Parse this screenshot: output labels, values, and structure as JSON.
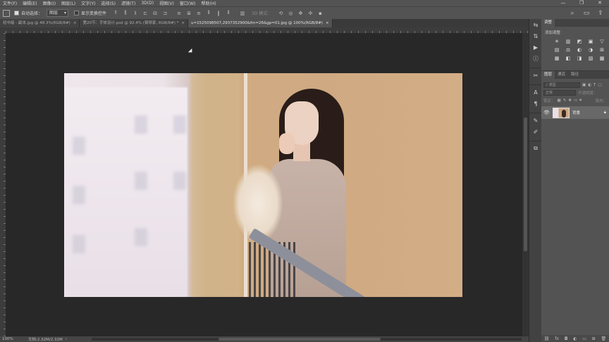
{
  "menu": [
    "文件(F)",
    "编辑(E)",
    "图像(I)",
    "图层(L)",
    "文字(Y)",
    "选择(S)",
    "滤镜(T)",
    "3D(D)",
    "视图(V)",
    "窗口(W)",
    "帮助(H)"
  ],
  "window_controls": [
    "—",
    "❐",
    "✕"
  ],
  "options": {
    "auto_select_label": "自动选择：",
    "auto_select_value": "图层",
    "show_transform_label": "显示变换控件",
    "mode_3d_label": "3D 模式："
  },
  "tabs": [
    {
      "label": "初中级 - 副本.jpg @ 48.3%(RGB/8#)",
      "active": false
    },
    {
      "label": "第20节：字体设计.psd @ 92.4% (钢琴家, RGB/8#) *",
      "active": false
    },
    {
      "label": "u=1525098507,2937352900&fm=26&gp=01.jpg @ 100%(RGB/8#)",
      "active": true
    }
  ],
  "status": {
    "zoom": "100%",
    "doc": "文档:2.32M/2.32M"
  },
  "panels": {
    "top_tabs": [
      "调整"
    ],
    "adjust_title": "添加调整",
    "adjust_icons": [
      "☀",
      "▥",
      "◩",
      "▣",
      "▽",
      "▤",
      "⚖",
      "◐",
      "◑",
      "⊞",
      "▦",
      "◧",
      "◨",
      "▧",
      "▩"
    ],
    "layer_tabs": [
      "图层",
      "通道",
      "路径"
    ],
    "filter_label": "♪ 类型",
    "blend_mode": "正常",
    "opacity_label": "不透明度：",
    "lock_label": "锁定：",
    "fill_label": "填充：",
    "layer_name": "背景"
  }
}
